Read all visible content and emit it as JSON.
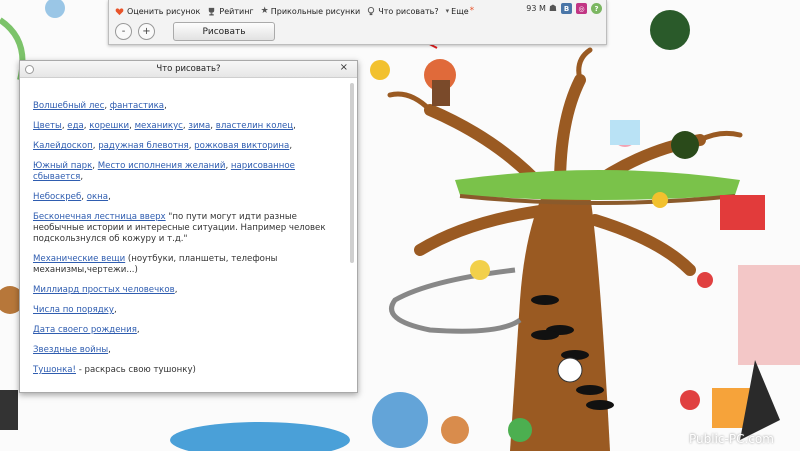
{
  "toolbar": {
    "menu": {
      "rate": "Оценить рисунок",
      "rating": "Рейтинг",
      "funny": "Прикольные рисунки",
      "what_draw": "Что рисовать?",
      "more": "Еще"
    },
    "status": "93 M",
    "zoom_out": "-",
    "zoom_in": "+",
    "draw_button": "Рисовать"
  },
  "dialog": {
    "title": "Что рисовать?",
    "close": "×",
    "items": [
      {
        "links": [
          "Волшебный лес",
          "фантастика"
        ],
        "sep": [
          ", ",
          ","
        ],
        "text": ""
      },
      {
        "links": [
          "Цветы",
          "еда",
          "корешки",
          "механикус",
          "зима",
          "властелин колец"
        ],
        "text": ""
      },
      {
        "links": [
          "Калейдоскоп",
          "радужная блевотня",
          "рожковая викторина"
        ],
        "text": ""
      },
      {
        "links": [
          "Южный парк",
          "Место исполнения желаний",
          "нарисованное сбывается"
        ],
        "text": ""
      },
      {
        "links": [
          "Небоскреб",
          "окна"
        ],
        "text": ""
      },
      {
        "links": [
          "Бесконечная лестница вверх"
        ],
        "text": " \"по пути могут идти разные необычные истории и интересные ситуации. Например человек подскользнулся об кожуру и т.д.\""
      },
      {
        "links": [
          "Механические вещи"
        ],
        "text": " (ноутбуки, планшеты, телефоны механизмы,чертежи...)"
      },
      {
        "links": [
          "Миллиард простых человечков"
        ],
        "text": ""
      },
      {
        "links": [
          "Числа по порядку"
        ],
        "text": ""
      },
      {
        "links": [
          "Дата своего рождения"
        ],
        "text": ""
      },
      {
        "links": [
          "Звездные войны"
        ],
        "text": ""
      },
      {
        "links": [
          "Тушонка!"
        ],
        "text": " - раскрась свою тушонку)"
      }
    ]
  },
  "watermark": "Public-PC.com",
  "colors": {
    "link": "#2f5db0",
    "arrow": "#e02020",
    "accent": "#e8542a"
  }
}
